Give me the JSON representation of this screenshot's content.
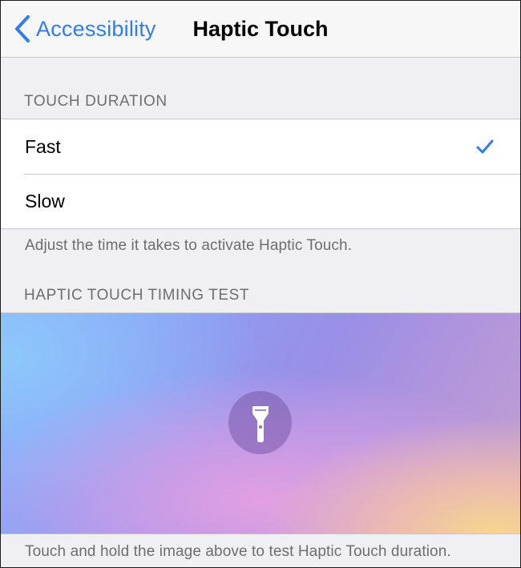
{
  "navbar": {
    "back_label": "Accessibility",
    "title": "Haptic Touch"
  },
  "touch_duration": {
    "header": "TOUCH DURATION",
    "options": [
      {
        "label": "Fast",
        "selected": true
      },
      {
        "label": "Slow",
        "selected": false
      }
    ],
    "footer": "Adjust the time it takes to activate Haptic Touch."
  },
  "timing_test": {
    "header": "HAPTIC TOUCH TIMING TEST",
    "icon": "flashlight-icon",
    "footer": "Touch and hold the image above to test Haptic Touch duration."
  },
  "colors": {
    "accent": "#2f7cf6",
    "background": "#efeff4",
    "secondary_text": "#6d6d72"
  }
}
